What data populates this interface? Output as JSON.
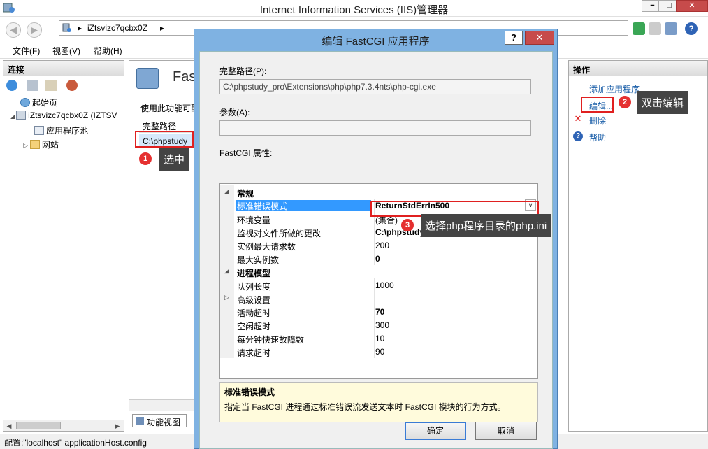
{
  "window": {
    "title": "Internet Information Services (IIS)管理器",
    "controls": [
      "−",
      "□",
      "✕"
    ]
  },
  "address": {
    "crumbs": [
      "iZtsvizc7qcbx0Z"
    ],
    "separator": "▸"
  },
  "menu": [
    "文件(F)",
    "视图(V)",
    "帮助(H)"
  ],
  "connections": {
    "header": "连接",
    "tree": [
      {
        "label": "起始页",
        "icon": "start-page-icon"
      },
      {
        "label": "iZtsvizc7qcbx0Z (IZTSV",
        "icon": "server-icon",
        "expander": "◢"
      },
      {
        "label": "应用程序池",
        "icon": "app-pool-icon"
      },
      {
        "label": "网站",
        "icon": "sites-folder-icon",
        "expander": "▷"
      }
    ]
  },
  "center": {
    "feature_title": "Fast",
    "description": "使用此功能可配",
    "column_header": "完整路径",
    "rows": [
      "C:\\phpstudy"
    ],
    "tab": "功能视图"
  },
  "actions": {
    "header": "操作",
    "items": [
      {
        "label": "添加应用程序...",
        "icon": ""
      },
      {
        "label": "编辑...",
        "icon": ""
      },
      {
        "label": "删除",
        "icon": "✕"
      },
      {
        "label": "帮助",
        "icon": "?"
      }
    ]
  },
  "status": {
    "text": "配置:\"localhost\" applicationHost.config"
  },
  "annotations": [
    {
      "num": "1",
      "text": "选中"
    },
    {
      "num": "2",
      "text": "双击编辑"
    },
    {
      "num": "3",
      "text": "选择php程序目录的php.ini"
    }
  ],
  "dialog": {
    "title": "编辑 FastCGI 应用程序",
    "help_btn": "?",
    "close_btn": "✕",
    "full_path_label": "完整路径(P):",
    "full_path_value": "C:\\phpstudy_pro\\Extensions\\php\\php7.3.4nts\\php-cgi.exe",
    "args_label": "参数(A):",
    "args_value": "",
    "props_label": "FastCGI 属性:",
    "property_grid": [
      {
        "type": "category",
        "toggle": "◢",
        "name": "常规"
      },
      {
        "type": "prop",
        "name": "标准错误模式",
        "value": "ReturnStdErrIn500",
        "selected": true,
        "bold": true,
        "dropdown": "∨"
      },
      {
        "type": "prop",
        "name": "环境变量",
        "value": "(集合)"
      },
      {
        "type": "prop",
        "name": "监视对文件所做的更改",
        "value": "C:\\phpstudy_pro\\Extensions\\php\\php",
        "bold": true
      },
      {
        "type": "prop",
        "name": "实例最大请求数",
        "value": "200"
      },
      {
        "type": "prop",
        "name": "最大实例数",
        "value": "0",
        "bold": true
      },
      {
        "type": "category",
        "toggle": "◢",
        "name": "进程模型"
      },
      {
        "type": "prop",
        "name": "队列长度",
        "value": "1000"
      },
      {
        "type": "prop",
        "name": "高级设置",
        "value": "",
        "toggle": "▷"
      },
      {
        "type": "prop",
        "name": "活动超时",
        "value": "70",
        "bold": true
      },
      {
        "type": "prop",
        "name": "空闲超时",
        "value": "300"
      },
      {
        "type": "prop",
        "name": "每分钟快速故障数",
        "value": "10"
      },
      {
        "type": "prop",
        "name": "请求超时",
        "value": "90"
      }
    ],
    "desc_title": "标准错误模式",
    "desc_text": "指定当 FastCGI 进程通过标准错误流发送文本时 FastCGI 模块的行为方式。",
    "ok": "确定",
    "cancel": "取消"
  }
}
